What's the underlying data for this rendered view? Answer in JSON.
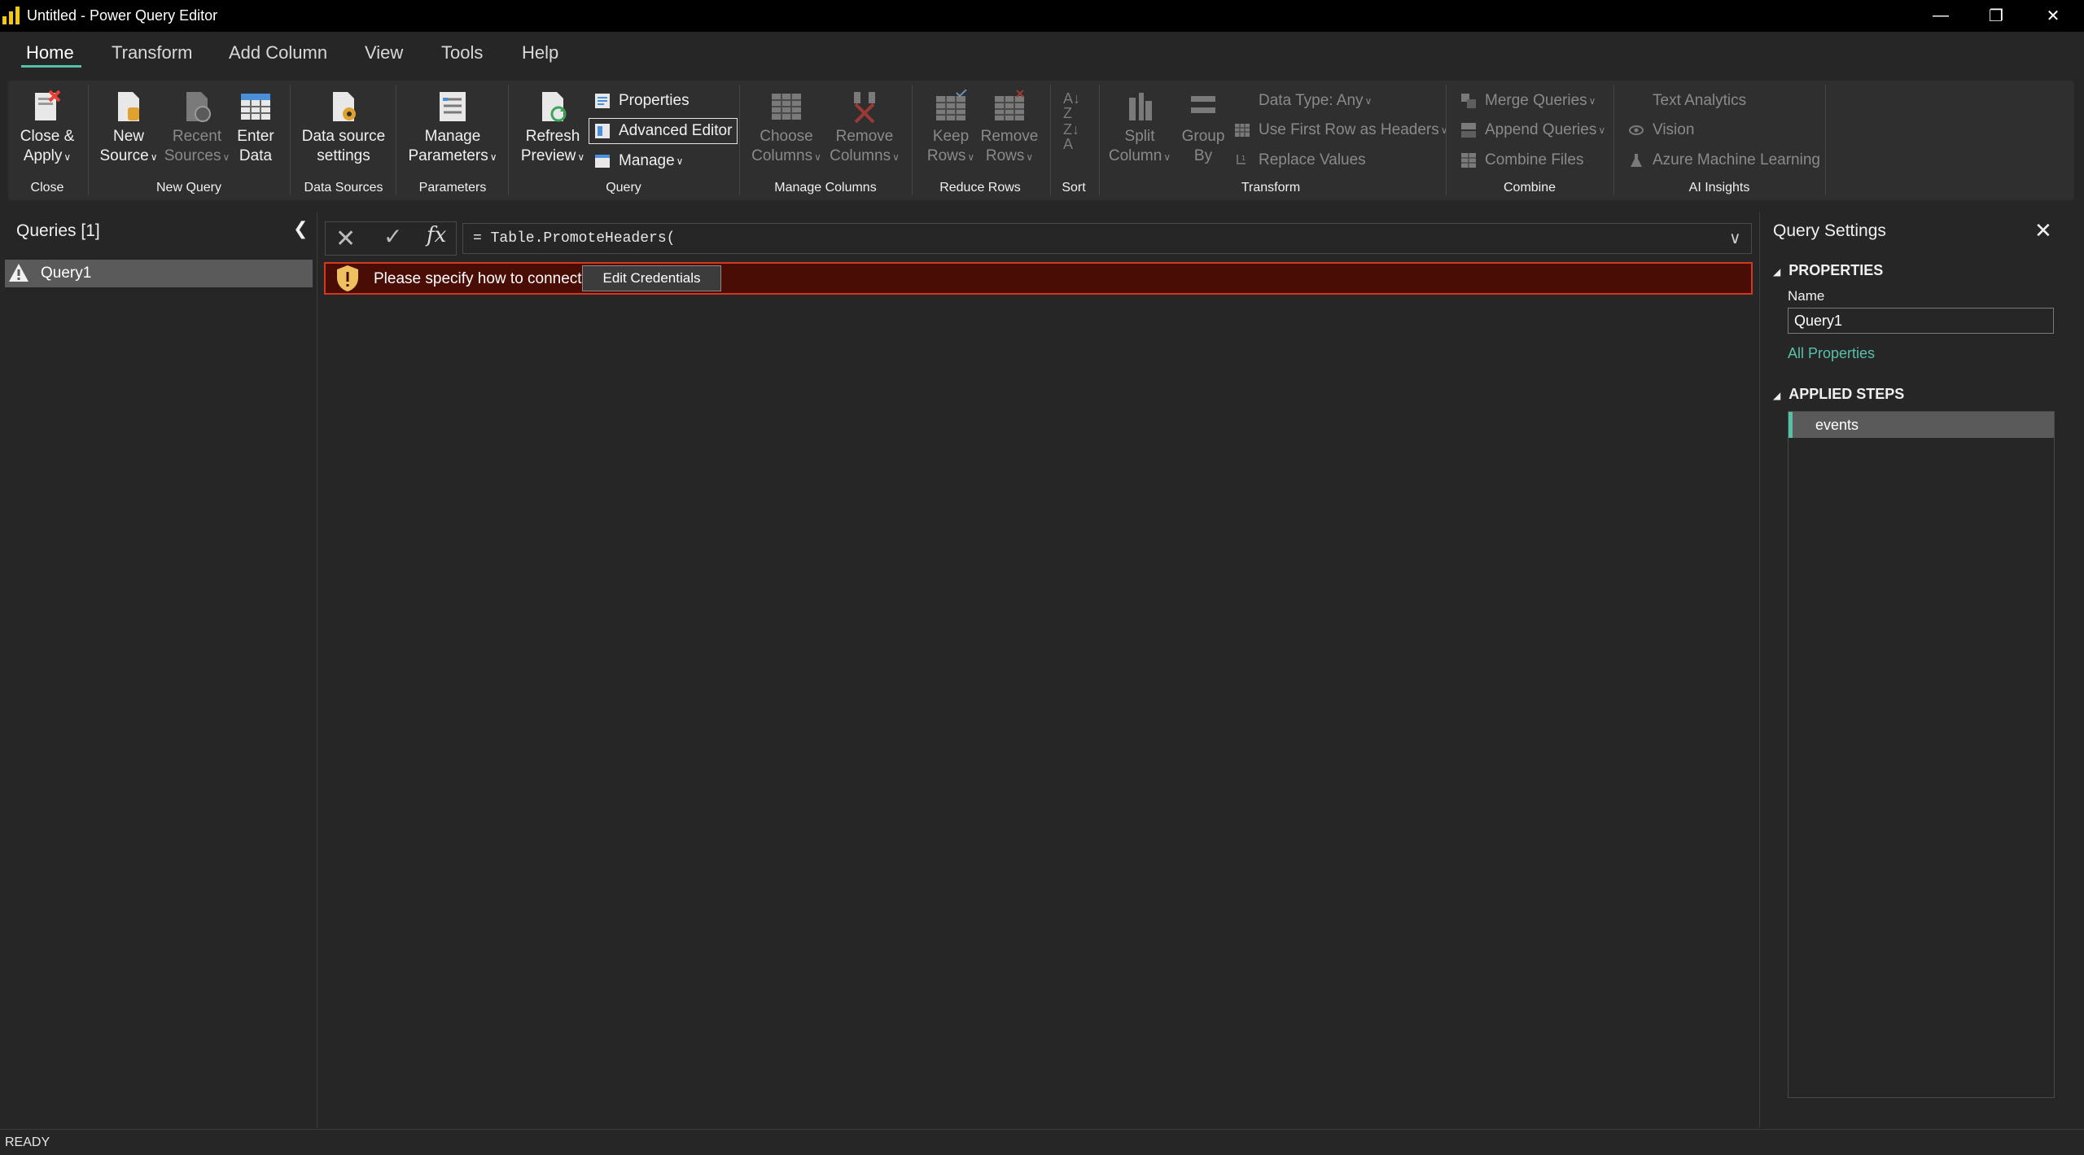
{
  "window": {
    "title": "Untitled - Power Query Editor",
    "controls": [
      "minimize",
      "restore",
      "close"
    ]
  },
  "tabs": [
    {
      "label": "Home",
      "active": true
    },
    {
      "label": "Transform"
    },
    {
      "label": "Add Column"
    },
    {
      "label": "View"
    },
    {
      "label": "Tools"
    },
    {
      "label": "Help"
    }
  ],
  "ribbon": {
    "groups": {
      "close": "Close",
      "new_query": "New Query",
      "data_sources": "Data Sources",
      "parameters": "Parameters",
      "query": "Query",
      "manage_columns": "Manage Columns",
      "reduce_rows": "Reduce Rows",
      "sort": "Sort",
      "transform": "Transform",
      "combine": "Combine",
      "ai_insights": "AI Insights"
    },
    "close_apply": [
      "Close &",
      "Apply"
    ],
    "new_source": [
      "New",
      "Source"
    ],
    "recent_sources": [
      "Recent",
      "Sources"
    ],
    "enter_data": [
      "Enter",
      "Data"
    ],
    "data_source_settings": [
      "Data source",
      "settings"
    ],
    "manage_parameters": [
      "Manage",
      "Parameters"
    ],
    "refresh_preview": [
      "Refresh",
      "Preview"
    ],
    "properties": "Properties",
    "advanced_editor": "Advanced Editor",
    "manage": "Manage",
    "choose_columns": [
      "Choose",
      "Columns"
    ],
    "remove_columns": [
      "Remove",
      "Columns"
    ],
    "keep_rows": [
      "Keep",
      "Rows"
    ],
    "remove_rows": [
      "Remove",
      "Rows"
    ],
    "split_column": [
      "Split",
      "Column"
    ],
    "group_by": [
      "Group",
      "By"
    ],
    "data_type": "Data Type: Any",
    "use_first_row": "Use First Row as Headers",
    "replace_values": "Replace Values",
    "merge_queries": "Merge Queries",
    "append_queries": "Append Queries",
    "combine_files": "Combine Files",
    "text_analytics": "Text Analytics",
    "vision": "Vision",
    "azure_ml": "Azure Machine Learning"
  },
  "queries_pane": {
    "title": "Queries [1]",
    "items": [
      {
        "label": "Query1",
        "status": "warning"
      }
    ]
  },
  "formula_bar": {
    "fx": "fx",
    "formula": "= Table.PromoteHeaders("
  },
  "warning": {
    "message": "Please specify how to connect.",
    "button": "Edit Credentials"
  },
  "settings_pane": {
    "title": "Query Settings",
    "properties_header": "PROPERTIES",
    "name_label": "Name",
    "name_value": "Query1",
    "all_properties": "All Properties",
    "applied_steps_header": "APPLIED STEPS",
    "steps": [
      "events"
    ]
  },
  "status": "READY",
  "colors": {
    "accent": "#57c1a8",
    "warning_bg": "#4a0d06",
    "warning_border": "#d23a1e",
    "app_icon": "#f2c811"
  }
}
